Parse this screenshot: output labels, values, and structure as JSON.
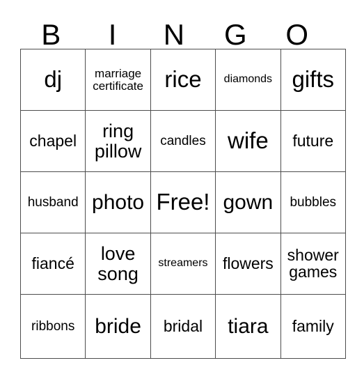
{
  "card": {
    "title": "BINGO",
    "headers": [
      "B",
      "I",
      "N",
      "G",
      "O"
    ],
    "rows": [
      [
        {
          "label": "dj",
          "size": "fs-xxl"
        },
        {
          "label": "marriage\ncertificate",
          "size": "fs-xs"
        },
        {
          "label": "rice",
          "size": "fs-xxl"
        },
        {
          "label": "diamonds",
          "size": "fs-xxs"
        },
        {
          "label": "gifts",
          "size": "fs-xxl"
        }
      ],
      [
        {
          "label": "chapel",
          "size": "fs-m"
        },
        {
          "label": "ring\npillow",
          "size": "fs-l"
        },
        {
          "label": "candles",
          "size": "fs-s"
        },
        {
          "label": "wife",
          "size": "fs-xxl"
        },
        {
          "label": "future",
          "size": "fs-m"
        }
      ],
      [
        {
          "label": "husband",
          "size": "fs-s"
        },
        {
          "label": "photo",
          "size": "fs-xl"
        },
        {
          "label": "Free!",
          "size": "fs-xxl"
        },
        {
          "label": "gown",
          "size": "fs-xl"
        },
        {
          "label": "bubbles",
          "size": "fs-s"
        }
      ],
      [
        {
          "label": "fiancé",
          "size": "fs-m"
        },
        {
          "label": "love\nsong",
          "size": "fs-l"
        },
        {
          "label": "streamers",
          "size": "fs-xxs"
        },
        {
          "label": "flowers",
          "size": "fs-m"
        },
        {
          "label": "shower\ngames",
          "size": "fs-m"
        }
      ],
      [
        {
          "label": "ribbons",
          "size": "fs-s"
        },
        {
          "label": "bride",
          "size": "fs-xl"
        },
        {
          "label": "bridal",
          "size": "fs-m"
        },
        {
          "label": "tiara",
          "size": "fs-xl"
        },
        {
          "label": "family",
          "size": "fs-m"
        }
      ]
    ],
    "free_space": "Free!",
    "colors": {
      "text": "#000000",
      "grid_line": "#4d4d4d",
      "background": "#ffffff"
    }
  }
}
